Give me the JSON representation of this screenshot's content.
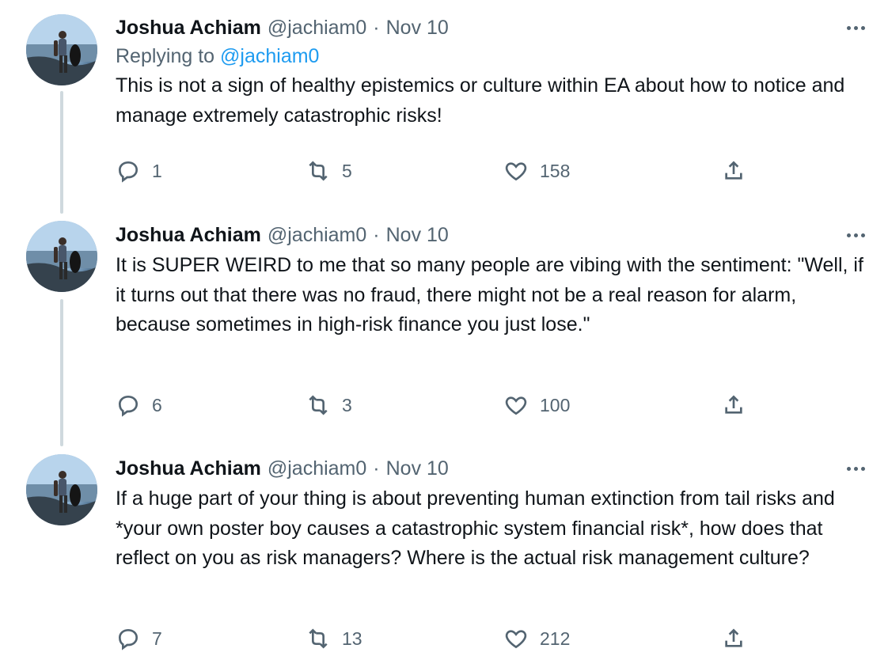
{
  "tweets": [
    {
      "author_name": "Joshua Achiam",
      "handle": "@jachiam0",
      "separator": "·",
      "date": "Nov 10",
      "replying_prefix": "Replying to",
      "replying_to": "@jachiam0",
      "text": "This is not a sign of healthy epistemics or culture within EA about how to notice and manage extremely catastrophic risks!",
      "replies": "1",
      "retweets": "5",
      "likes": "158"
    },
    {
      "author_name": "Joshua Achiam",
      "handle": "@jachiam0",
      "separator": "·",
      "date": "Nov 10",
      "text": "It is SUPER WEIRD to me that so many people are vibing with the sentiment: \"Well, if it turns out that there was no fraud, there might not be a real reason for alarm, because sometimes in high-risk finance you just lose.\"",
      "replies": "6",
      "retweets": "3",
      "likes": "100"
    },
    {
      "author_name": "Joshua Achiam",
      "handle": "@jachiam0",
      "separator": "·",
      "date": "Nov 10",
      "text": "If a huge part of your thing is about preventing human extinction from tail risks and *your own poster boy causes a catastrophic system financial risk*, how does that reflect on you as risk managers? Where is the actual risk management culture?",
      "replies": "7",
      "retweets": "13",
      "likes": "212"
    }
  ],
  "icons": {
    "reply": "reply-icon",
    "retweet": "retweet-icon",
    "like": "heart-icon",
    "share": "share-icon",
    "more": "more-icon"
  },
  "colors": {
    "text": "#0f1419",
    "secondary": "#536471",
    "link": "#1d9bf0",
    "thread_line": "#cfd9de"
  }
}
